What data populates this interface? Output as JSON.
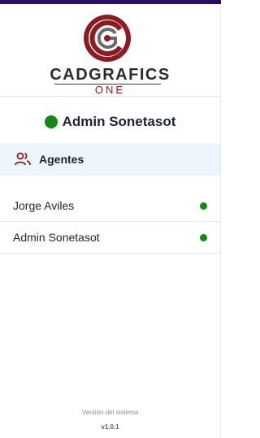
{
  "logo": {
    "word": "CADGRAFICS",
    "sub": "ONE",
    "brand_color": "#8a1c22"
  },
  "header": {
    "user_name": "Admin Sonetasot",
    "status_color": "#0f8a16"
  },
  "section": {
    "icon": "users-icon",
    "label": "Agentes",
    "bg": "#edf6fc"
  },
  "agents": [
    {
      "name": "Jorge Aviles",
      "status": "online"
    },
    {
      "name": "Admin Sonetasot",
      "status": "online"
    }
  ],
  "footer": {
    "label": "Versión del sistema",
    "version": "v1.0.1"
  },
  "colors": {
    "topbar": "#24105f",
    "online": "#108a16"
  }
}
